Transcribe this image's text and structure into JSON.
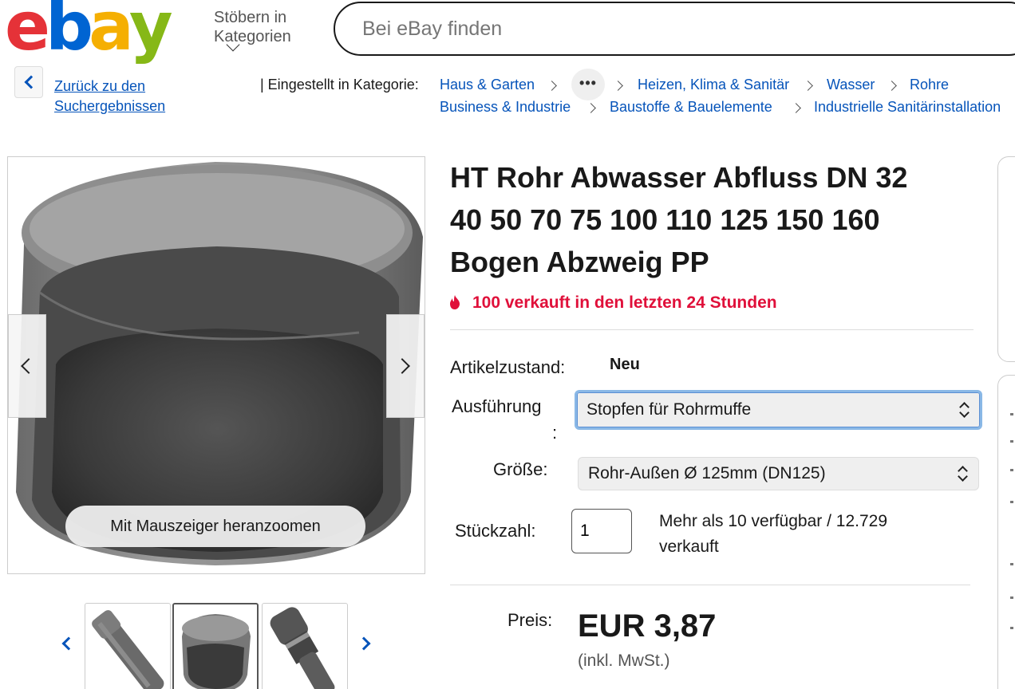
{
  "header": {
    "logo_letters": [
      "e",
      "b",
      "a",
      "y"
    ],
    "browse_label_line1": "Stöbern in",
    "browse_label_line2": "Kategorien",
    "search_placeholder": "Bei eBay finden"
  },
  "breadcrumb": {
    "back_line1": "Zurück zu den",
    "back_line2": "Suchergebnissen",
    "label": "| Eingestellt in Kategorie:",
    "row1": [
      "Haus & Garten",
      "Heizen, Klima & Sanitär",
      "Wasser",
      "Rohre"
    ],
    "more": "•••",
    "row2": [
      "Business & Industrie",
      "Baustoffe & Bauelemente",
      "Industrielle Sanitärinstallation"
    ]
  },
  "gallery": {
    "zoom_hint": "Mit Mauszeiger heranzoomen",
    "thumbnails": [
      "rohr",
      "stopfen",
      "abzweig"
    ],
    "active_thumbnail": 1
  },
  "product": {
    "title_line1": "HT Rohr Abwasser Abfluss DN 32",
    "title_line2": "40 50 70 75 100 110 125 150 160",
    "title_line3": "Bogen Abzweig PP",
    "hot_text": "100 verkauft in den letzten 24 Stunden",
    "condition_label": "Artikelzustand:",
    "condition_value": "Neu",
    "variant_label_line1": "Ausführung",
    "variant_label_line2": ":",
    "variant_value": "Stopfen für Rohrmuffe",
    "size_label": "Größe:",
    "size_value": "Rohr-Außen Ø 125mm (DN125)",
    "qty_label": "Stückzahl:",
    "qty_value": "1",
    "avail_line1": "Mehr als 10 verfügbar / 12.729",
    "avail_line2": "verkauft",
    "price_label": "Preis:",
    "price": "EUR 3,87",
    "vat": "(inkl. MwSt.)"
  },
  "colors": {
    "link": "#0654ba",
    "hot": "#e0103a",
    "logo_red": "#e53238",
    "logo_blue": "#0064d2",
    "logo_yellow": "#f5af02",
    "logo_green": "#86b817"
  }
}
